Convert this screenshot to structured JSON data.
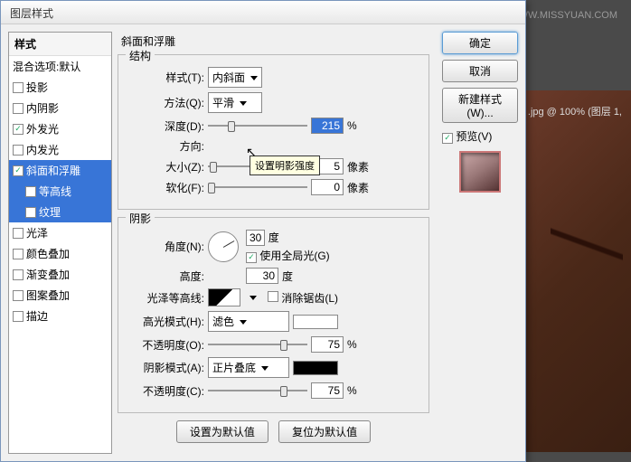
{
  "watermark": "思缘设计论坛  WWW.MISSYUAN.COM",
  "bg_doc_title": ".jpg @ 100% (图层 1,",
  "dialog_title": "图层样式",
  "sidebar": {
    "header": "样式",
    "blend_defaults": "混合选项:默认",
    "items": [
      {
        "label": "投影",
        "checked": false,
        "selected": false
      },
      {
        "label": "内阴影",
        "checked": false,
        "selected": false
      },
      {
        "label": "外发光",
        "checked": true,
        "selected": false
      },
      {
        "label": "内发光",
        "checked": false,
        "selected": false
      },
      {
        "label": "斜面和浮雕",
        "checked": true,
        "selected": true
      },
      {
        "label": "等高线",
        "checked": false,
        "selected": true,
        "sub": true
      },
      {
        "label": "纹理",
        "checked": false,
        "selected": true,
        "sub": true
      },
      {
        "label": "光泽",
        "checked": false,
        "selected": false
      },
      {
        "label": "颜色叠加",
        "checked": false,
        "selected": false
      },
      {
        "label": "渐变叠加",
        "checked": false,
        "selected": false
      },
      {
        "label": "图案叠加",
        "checked": false,
        "selected": false
      },
      {
        "label": "描边",
        "checked": false,
        "selected": false
      }
    ]
  },
  "panel_title": "斜面和浮雕",
  "structure": {
    "legend": "结构",
    "style_lbl": "样式(T):",
    "style_val": "内斜面",
    "method_lbl": "方法(Q):",
    "method_val": "平滑",
    "depth_lbl": "深度(D):",
    "depth_val": "215",
    "depth_unit": "%",
    "dir_lbl": "方向:",
    "size_lbl": "大小(Z):",
    "size_val": "5",
    "size_unit": "像素",
    "soften_lbl": "软化(F):",
    "soften_val": "0",
    "soften_unit": "像素"
  },
  "tooltip": "设置明影强度",
  "shadow": {
    "legend": "阴影",
    "angle_lbl": "角度(N):",
    "angle_val": "30",
    "angle_unit": "度",
    "global_lbl": "使用全局光(G)",
    "alt_lbl": "高度:",
    "alt_val": "30",
    "alt_unit": "度",
    "gloss_lbl": "光泽等高线:",
    "anti_lbl": "消除锯齿(L)",
    "hmode_lbl": "高光模式(H):",
    "hmode_val": "滤色",
    "hopac_lbl": "不透明度(O):",
    "hopac_val": "75",
    "pct": "%",
    "smode_lbl": "阴影模式(A):",
    "smode_val": "正片叠底",
    "sopac_lbl": "不透明度(C):",
    "sopac_val": "75"
  },
  "footer": {
    "make_default": "设置为默认值",
    "reset_default": "复位为默认值"
  },
  "buttons": {
    "ok": "确定",
    "cancel": "取消",
    "new_style": "新建样式(W)...",
    "preview": "预览(V)"
  }
}
